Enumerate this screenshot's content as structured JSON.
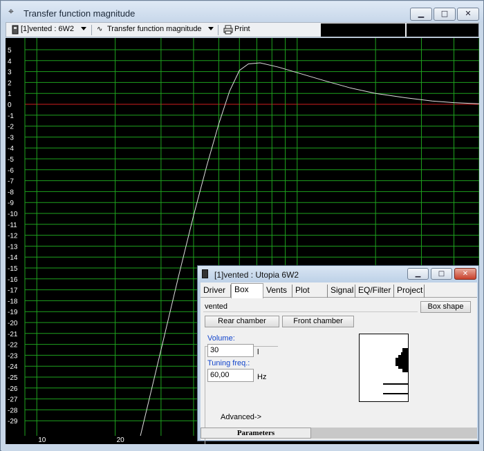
{
  "window": {
    "title": "Transfer function magnitude",
    "icon": "crosshair-icon",
    "minimize": "▁",
    "maximize": "□",
    "close": "✕"
  },
  "toolbar": {
    "project_selector": "[1]vented : 6W2",
    "plot_selector": "Transfer function magnitude",
    "print_label": "Print"
  },
  "plot": {
    "background": "#000000",
    "grid_color": "#1ea31e",
    "zero_line_color": "#d21e1e",
    "curve_color": "#e0e0e0",
    "y_ticks": [
      "5",
      "4",
      "3",
      "2",
      "1",
      "0",
      "-1",
      "-2",
      "-3",
      "-4",
      "-5",
      "-6",
      "-7",
      "-8",
      "-9",
      "-10",
      "-11",
      "-12",
      "-13",
      "-14",
      "-15",
      "-16",
      "-17",
      "-18",
      "-19",
      "-20",
      "-21",
      "-22",
      "-23",
      "-24",
      "-25",
      "-26",
      "-27",
      "-28",
      "-29"
    ],
    "x_ticks": [
      "10",
      "20"
    ],
    "ylim": [
      -30,
      6
    ],
    "xlim": [
      9,
      500
    ],
    "x_scale": "log",
    "curve": [
      [
        25,
        -30
      ],
      [
        30,
        -22.5
      ],
      [
        35,
        -15.8
      ],
      [
        40,
        -10.2
      ],
      [
        45,
        -5.6
      ],
      [
        50,
        -1.8
      ],
      [
        55,
        1.2
      ],
      [
        60,
        3.1
      ],
      [
        65,
        3.7
      ],
      [
        72,
        3.8
      ],
      [
        85,
        3.4
      ],
      [
        100,
        2.9
      ],
      [
        130,
        2.1
      ],
      [
        160,
        1.5
      ],
      [
        200,
        1.0
      ],
      [
        260,
        0.6
      ],
      [
        330,
        0.3
      ],
      [
        400,
        0.15
      ],
      [
        500,
        0.05
      ]
    ]
  },
  "child_window": {
    "title": "[1]vented : Utopia 6W2",
    "tabs": [
      "Driver",
      "Box",
      "Vents",
      "Plot",
      "Signal",
      "EQ/Filter",
      "Project"
    ],
    "active_tab": "Box",
    "box_name": "vented",
    "box_shape_button": "Box shape",
    "rear_chamber_button": "Rear chamber",
    "front_chamber_button": "Front chamber",
    "volume_label": "Volume:",
    "volume_value": "30",
    "volume_unit": "l",
    "tuning_label": "Tuning freq.:",
    "tuning_value": "60,00",
    "tuning_unit": "Hz",
    "advanced_button": "Advanced->",
    "status_label": "Parameters"
  }
}
